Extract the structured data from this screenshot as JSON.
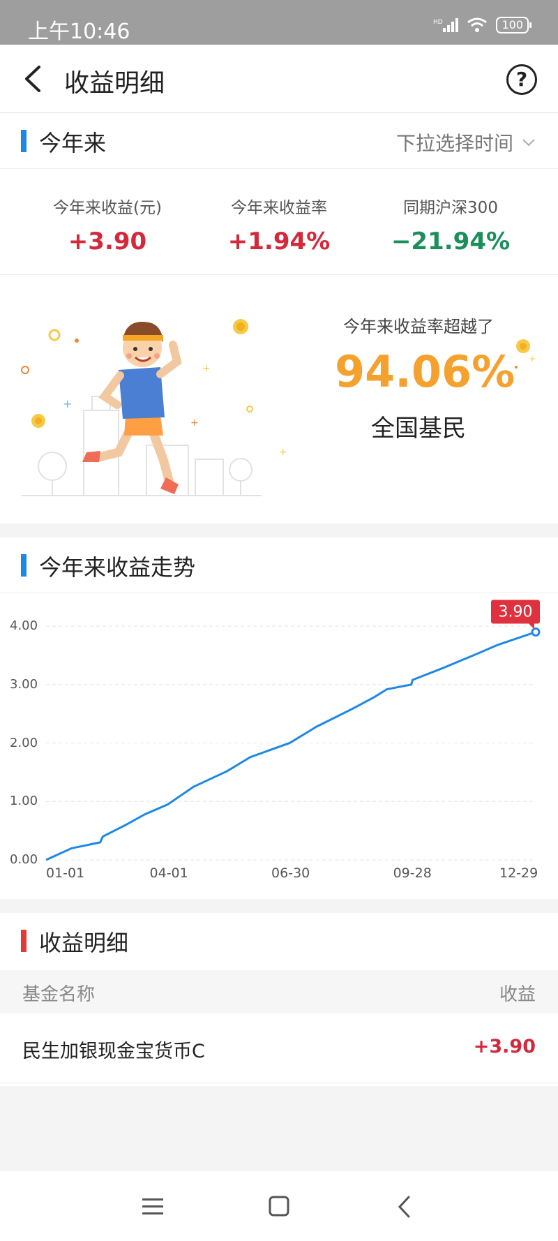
{
  "status_bar": {
    "time": "上午10:46",
    "battery": "100"
  },
  "nav": {
    "title": "收益明细",
    "help_icon": "question-circle-icon",
    "back_icon": "chevron-left-icon"
  },
  "period_section": {
    "title": "今年来",
    "selector_label": "下拉选择时间",
    "stats": [
      {
        "label": "今年来收益(元)",
        "value": "+3.90",
        "color": "#d3293a"
      },
      {
        "label": "今年来收益率",
        "value": "+1.94%",
        "color": "#d3293a"
      },
      {
        "label": "同期沪深300",
        "value": "−21.94%",
        "color": "#1a8f5a"
      }
    ],
    "rank": {
      "label": "今年来收益率超越了",
      "value": "94.06%",
      "subject": "全国基民"
    }
  },
  "trend_section": {
    "title": "今年来收益走势"
  },
  "chart_data": {
    "type": "line",
    "title": "今年来收益走势",
    "x_ticks": [
      "01-01",
      "04-01",
      "06-30",
      "09-28",
      "12-29"
    ],
    "y_ticks": [
      "0.00",
      "1.00",
      "2.00",
      "3.00",
      "4.00"
    ],
    "ylim": [
      0,
      4.3
    ],
    "grid": true,
    "line_color": "#1e88e5",
    "series": [
      {
        "x": [
          "01-01",
          "01-20",
          "02-10",
          "02-12",
          "03-01",
          "03-15",
          "04-01",
          "04-20",
          "05-15",
          "06-01",
          "06-30",
          "07-20",
          "08-15",
          "09-01",
          "09-10",
          "09-28",
          "09-29",
          "10-20",
          "11-15",
          "12-01",
          "12-29"
        ],
        "y": [
          0.0,
          0.2,
          0.3,
          0.4,
          0.6,
          0.78,
          0.95,
          1.25,
          1.52,
          1.76,
          2.0,
          2.28,
          2.58,
          2.79,
          2.92,
          3.0,
          3.08,
          3.27,
          3.52,
          3.68,
          3.9
        ]
      }
    ],
    "end_label": "3.90"
  },
  "detail_section": {
    "title": "收益明细",
    "columns": {
      "name": "基金名称",
      "gain": "收益"
    },
    "rows": [
      {
        "name": "民生加银现金宝货币C",
        "gain": "+3.90"
      }
    ]
  }
}
